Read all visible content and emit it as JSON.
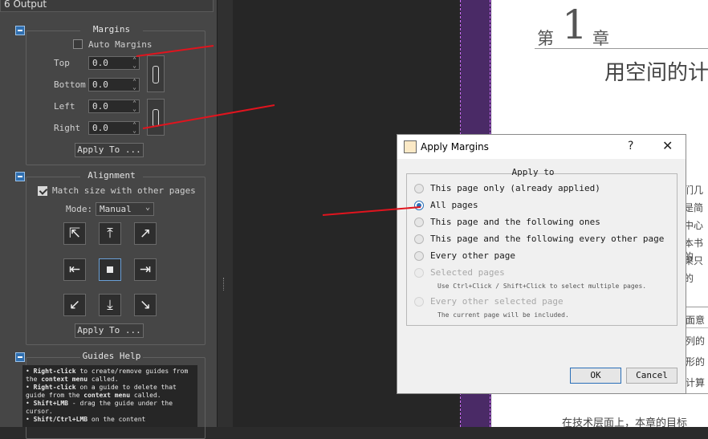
{
  "panel": {
    "output_header": "6  Output",
    "margins": {
      "title": "Margins",
      "auto_margins_label": "Auto Margins",
      "fields": [
        {
          "label": "Top",
          "value": "0.0"
        },
        {
          "label": "Bottom",
          "value": "0.0"
        },
        {
          "label": "Left",
          "value": "0.0"
        },
        {
          "label": "Right",
          "value": "0.0"
        }
      ],
      "apply_to": "Apply To ..."
    },
    "alignment": {
      "title": "Alignment",
      "match_size_label": "Match size with other pages",
      "mode_label": "Mode:",
      "mode_value": "Manual",
      "apply_to": "Apply To ..."
    },
    "guides_help": {
      "title": "Guides Help"
    }
  },
  "dialog": {
    "title": "Apply Margins",
    "help": "?",
    "close": "✕",
    "group_title": "Apply to",
    "options": [
      {
        "label": "This page only (already applied)",
        "selected": false,
        "disabled": false
      },
      {
        "label": "All pages",
        "selected": true,
        "disabled": false
      },
      {
        "label": "This page and the following ones",
        "selected": false,
        "disabled": false
      },
      {
        "label": "This page and the following every other page",
        "selected": false,
        "disabled": false
      },
      {
        "label": "Every other page",
        "selected": false,
        "disabled": false
      },
      {
        "label": "Selected pages",
        "selected": false,
        "disabled": true
      },
      {
        "label": "Every other selected page",
        "selected": false,
        "disabled": true
      }
    ],
    "hint_selected": "Use Ctrl+Click / Shift+Click to select multiple pages.",
    "hint_every_other": "The current page will be included.",
    "ok": "OK",
    "cancel": "Cancel"
  },
  "document": {
    "chapter_prefix": "第",
    "chapter_number": "1",
    "chapter_suffix": "章",
    "chapter_title": "用空间的计",
    "side_fragments": [
      "们几",
      "是简",
      "中心",
      "本书的",
      "果只",
      "的",
      "面意",
      "列的",
      "形的",
      "计算"
    ],
    "bottom_line": "在技术层面上，本章的目标"
  },
  "colors": {
    "annotation_red": "#e0141e",
    "accent_blue": "#2a6fb8",
    "purple_band": "#4a2a66"
  }
}
